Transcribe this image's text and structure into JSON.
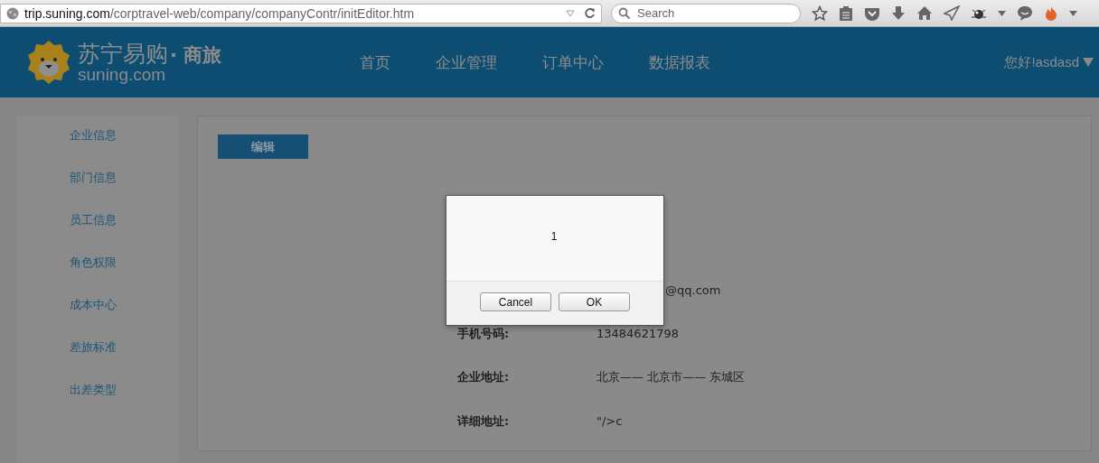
{
  "browser": {
    "url_host": "trip.suning.com",
    "url_path": "/corptravel-web/company/companyContr/initEditor.htm",
    "search": {
      "placeholder": "Search"
    }
  },
  "header": {
    "logo_text": "苏宁易购",
    "logo_suffix": "· 商旅",
    "logo_domain": "suning.com",
    "nav": [
      {
        "label": "首页"
      },
      {
        "label": "企业管理"
      },
      {
        "label": "订单中心"
      },
      {
        "label": "数据报表"
      }
    ],
    "user": "您好!asdasd"
  },
  "sidebar": {
    "items": [
      {
        "label": "企业信息"
      },
      {
        "label": "部门信息"
      },
      {
        "label": "员工信息"
      },
      {
        "label": "角色权限"
      },
      {
        "label": "成本中心"
      },
      {
        "label": "差旅标准"
      },
      {
        "label": "出差类型"
      }
    ]
  },
  "main": {
    "edit_button": "编辑",
    "rows": [
      {
        "kind": "covered"
      },
      {
        "kind": "covered"
      },
      {
        "kind": "partial",
        "value": "@qq.com"
      },
      {
        "kind": "full",
        "label": "手机号码:",
        "value": "13484621798"
      },
      {
        "kind": "full",
        "label": "企业地址:",
        "value": "北京—— 北京市—— 东城区"
      },
      {
        "kind": "full",
        "label": "详细地址:",
        "value": "\"/>c"
      }
    ]
  },
  "dialog": {
    "message": "1",
    "buttons": [
      {
        "label": "Cancel"
      },
      {
        "label": "OK"
      }
    ]
  }
}
